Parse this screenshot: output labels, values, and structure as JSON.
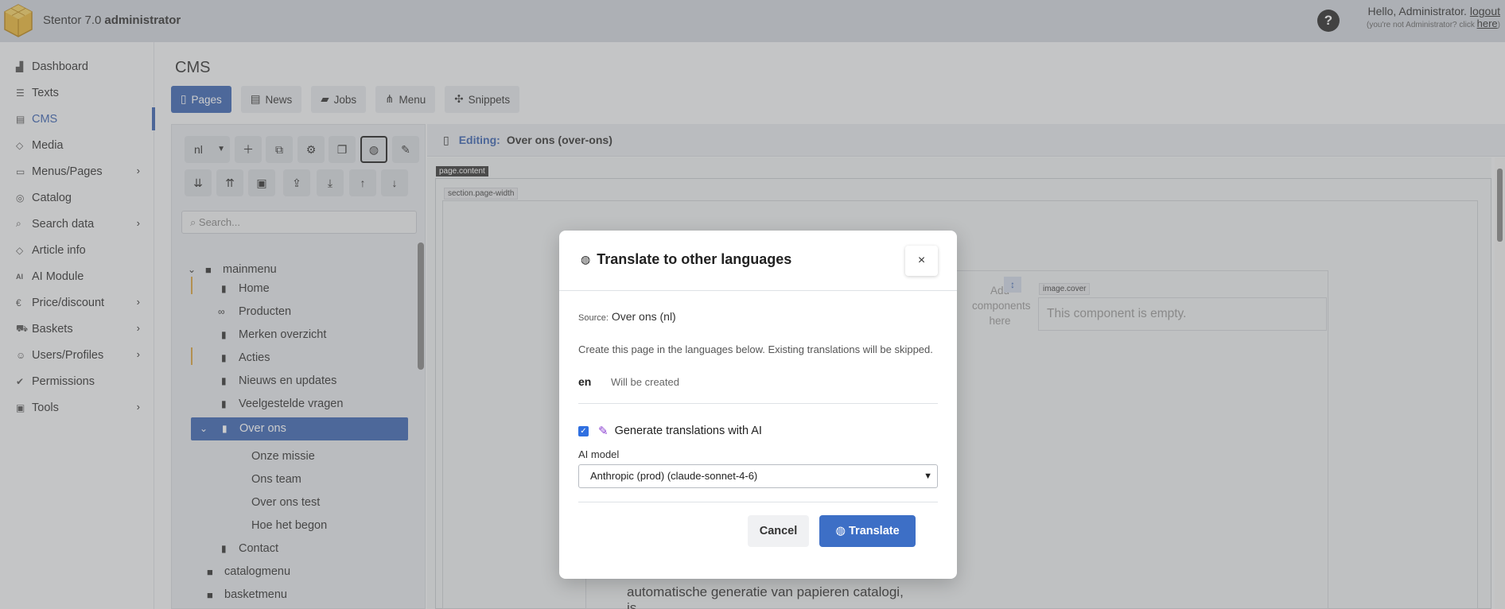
{
  "app": {
    "name": "Stentor 7.0",
    "user": "administrator",
    "help_label": "?",
    "greeting": "Hello, Administrator.",
    "logout_label": "logout",
    "not_user_text": "(you're not Administrator? click",
    "here_label": "here",
    "not_user_close": ")"
  },
  "sidebar": {
    "items": [
      {
        "label": "Dashboard",
        "icon": "chart-icon"
      },
      {
        "label": "Texts",
        "icon": "list-icon"
      },
      {
        "label": "CMS",
        "icon": "layout-icon",
        "active": true
      },
      {
        "label": "Media",
        "icon": "tag-icon"
      },
      {
        "label": "Menus/Pages",
        "icon": "window-icon",
        "arrow": "›"
      },
      {
        "label": "Catalog",
        "icon": "database-icon"
      },
      {
        "label": "Search data",
        "icon": "search-icon",
        "arrow": "›"
      },
      {
        "label": "Article info",
        "icon": "tag-icon"
      },
      {
        "label": "AI Module",
        "icon": "ai-icon"
      },
      {
        "label": "Price/discount",
        "icon": "euro-icon",
        "arrow": "›"
      },
      {
        "label": "Baskets",
        "icon": "cart-icon",
        "arrow": "›"
      },
      {
        "label": "Users/Profiles",
        "icon": "users-icon",
        "arrow": "›"
      },
      {
        "label": "Permissions",
        "icon": "check-icon"
      },
      {
        "label": "Tools",
        "icon": "box-icon",
        "arrow": "›"
      }
    ]
  },
  "main": {
    "title": "CMS",
    "tabs": [
      {
        "label": "Pages",
        "active": true
      },
      {
        "label": "News"
      },
      {
        "label": "Jobs"
      },
      {
        "label": "Menu"
      },
      {
        "label": "Snippets"
      }
    ]
  },
  "tree": {
    "language": "nl",
    "search_placeholder": "Search...",
    "items": [
      {
        "label": "mainmenu",
        "type": "folder"
      },
      {
        "label": "Home",
        "type": "page"
      },
      {
        "label": "Producten",
        "type": "link"
      },
      {
        "label": "Merken overzicht",
        "type": "page"
      },
      {
        "label": "Acties",
        "type": "page"
      },
      {
        "label": "Nieuws en updates",
        "type": "page"
      },
      {
        "label": "Veelgestelde vragen",
        "type": "page"
      },
      {
        "label": "Over ons",
        "type": "page",
        "selected": true
      },
      {
        "label": "Onze missie",
        "type": "sub"
      },
      {
        "label": "Ons team",
        "type": "sub"
      },
      {
        "label": "Over ons test",
        "type": "sub"
      },
      {
        "label": "Hoe het begon",
        "type": "sub"
      },
      {
        "label": "Contact",
        "type": "page"
      },
      {
        "label": "catalogmenu",
        "type": "folder"
      },
      {
        "label": "basketmenu",
        "type": "folder"
      }
    ]
  },
  "editor": {
    "editing_label": "Editing:",
    "page_name": "Over ons (over-ons)",
    "tag_page": "page.content",
    "tag_section": "section.page-width",
    "tag_image": "image.cover",
    "add_components": "Add components here",
    "empty_text": "This component is empty.",
    "bottom_text": "automatische generatie van papieren catalogi, is"
  },
  "modal": {
    "title": "Translate to other languages",
    "close_label": "×",
    "source_prefix": "Source:",
    "source_value": "Over ons (nl)",
    "description": "Create this page in the languages below. Existing translations will be skipped.",
    "languages": [
      {
        "code": "en",
        "status": "Will be created"
      }
    ],
    "ai_checkbox_label": "Generate translations with AI",
    "ai_checked": true,
    "model_label": "AI model",
    "model_value": "Anthropic (prod) (claude-sonnet-4-6)",
    "cancel_label": "Cancel",
    "translate_label": "Translate"
  },
  "colors": {
    "accent": "#3d66b3",
    "primary_button": "#3d6fc6",
    "highlight_marker": "#d9a441"
  }
}
